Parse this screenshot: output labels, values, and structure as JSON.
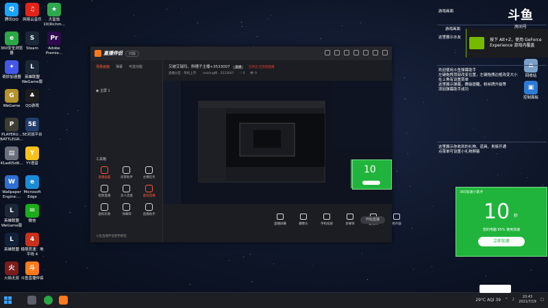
{
  "desktop": {
    "icons_left": [
      {
        "label": "腾讯QQ",
        "color": "#1aa3ff",
        "glyph": "Q"
      },
      {
        "label": "网易云音乐",
        "color": "#e2231a",
        "glyph": "♫"
      },
      {
        "label": "大富翁10(Richm...",
        "color": "#2fa84f",
        "glyph": "★"
      },
      {
        "label": "360安全浏览器",
        "color": "#2aa846",
        "glyph": "e"
      },
      {
        "label": "Steam",
        "color": "#1b2838",
        "glyph": "S"
      },
      {
        "label": "Adobe Premie...",
        "color": "#2c0a4c",
        "glyph": "Pr"
      },
      {
        "label": "奇妙加速器",
        "color": "#4457e8",
        "glyph": "✦"
      },
      {
        "label": "英雄联盟WeGame版",
        "color": "#1c2838",
        "glyph": "L"
      },
      {
        "label": "WeGame",
        "color": "#b3932a",
        "glyph": "G"
      },
      {
        "label": "QQ游戏",
        "color": "#1d1d1d",
        "glyph": "♣"
      },
      {
        "label": "PLAYERU... BATTLEGR...",
        "color": "#3d3d34",
        "glyph": "P"
      },
      {
        "label": "5E对战平台",
        "color": "#233c6a",
        "glyph": "5E"
      },
      {
        "label": "41ad05d6...",
        "color": "#6a6f7b",
        "glyph": "▤"
      },
      {
        "label": "YY语音",
        "color": "#f6c21b",
        "glyph": "Y"
      },
      {
        "label": "Wallpaper Engine:...",
        "color": "#2c6fd1",
        "glyph": "W"
      },
      {
        "label": "Microsoft Edge",
        "color": "#1a8bd6",
        "glyph": "e"
      },
      {
        "label": "英雄联盟WeGame版",
        "color": "#1c2838",
        "glyph": "L"
      },
      {
        "label": "微信",
        "color": "#1aad19",
        "glyph": "✉"
      },
      {
        "label": "英雄联盟",
        "color": "#10223a",
        "glyph": "L"
      },
      {
        "label": "极限竞速：地平线 4",
        "color": "#c9311d",
        "glyph": "4"
      },
      {
        "label": "火焰无双",
        "color": "#7c1b1b",
        "glyph": "火"
      },
      {
        "label": "斗鱼直播伴侣",
        "color": "#ff7a1a",
        "glyph": "斗"
      }
    ],
    "icons_right": [
      {
        "label": "控制面板",
        "color": "#2d7bd6",
        "glyph": "▣"
      },
      {
        "label": "回收站",
        "color": "#7aa0c8",
        "glyph": "⌂"
      }
    ]
  },
  "app": {
    "title": "直播伴侣",
    "version_badge": "旧版",
    "left_tabs": [
      "场景画面",
      "弹幕",
      "可选功能"
    ],
    "scene_item": "主屏 1",
    "tools_title": "工具箱",
    "tools": [
      {
        "label": "直播画面",
        "hot": true
      },
      {
        "label": "房管助手",
        "hot": false
      },
      {
        "label": "主播任务",
        "hot": false
      },
      {
        "label": "视频直播",
        "hot": false
      },
      {
        "label": "多人连麦",
        "hot": false
      },
      {
        "label": "虚拟直播",
        "hot": true
      },
      {
        "label": "虚拟形象",
        "hot": false
      },
      {
        "label": "弹幕库",
        "hot": false
      },
      {
        "label": "直播助手",
        "hot": false
      }
    ],
    "room_title": "又被艾瑞玛、斜槽子主播+3533007",
    "room_tag": "直播",
    "room_notice": "已开启·已连接直播",
    "room_sub": "直播分区 · 单机上市",
    "room_rank": "ranking榜 · 3533007",
    "room_likes": "0",
    "room_viewers": "0",
    "bottom_buttons": [
      "直播屏幕",
      "摄像头",
      "手机投屏",
      "多媒体",
      "麦克风",
      "扬声器"
    ],
    "start_label": "开始直播",
    "footer_text": "斗鱼直播伴侣使用教程"
  },
  "notes": {
    "top": "游戏画面",
    "top2": "游戏画面",
    "block1": [
      "欢迎使用斗鱼弹幕助手",
      "左键拖拽顶部改变位置，左键拖拽边框改变大小",
      "在上角有设置菜单",
      "这里展示弹幕，赛级提醒，粉丝牌升级等",
      "添加弹幕助手成功"
    ],
    "block2": [
      "这里展示你收到的礼物、道具、贵族开通",
      "点菜单可设置小礼物屏蔽"
    ],
    "side_label": "这里展示水友"
  },
  "nvidia": {
    "line1": "按下 Alt+Z，使用 GeForce",
    "line2": "Experience 游戏内覆盖"
  },
  "badge": {
    "big": "斗鱼",
    "small": "房间号",
    "num": "3533007"
  },
  "speed": {
    "header": "360加速小助手",
    "value": "10",
    "unit": "秒",
    "sub": "您的电脑 95% 使用加速",
    "button": "立即加速"
  },
  "taskbar": {
    "weather": "29°C AQI 39",
    "time": "20:43",
    "date": "2021/7/19"
  }
}
